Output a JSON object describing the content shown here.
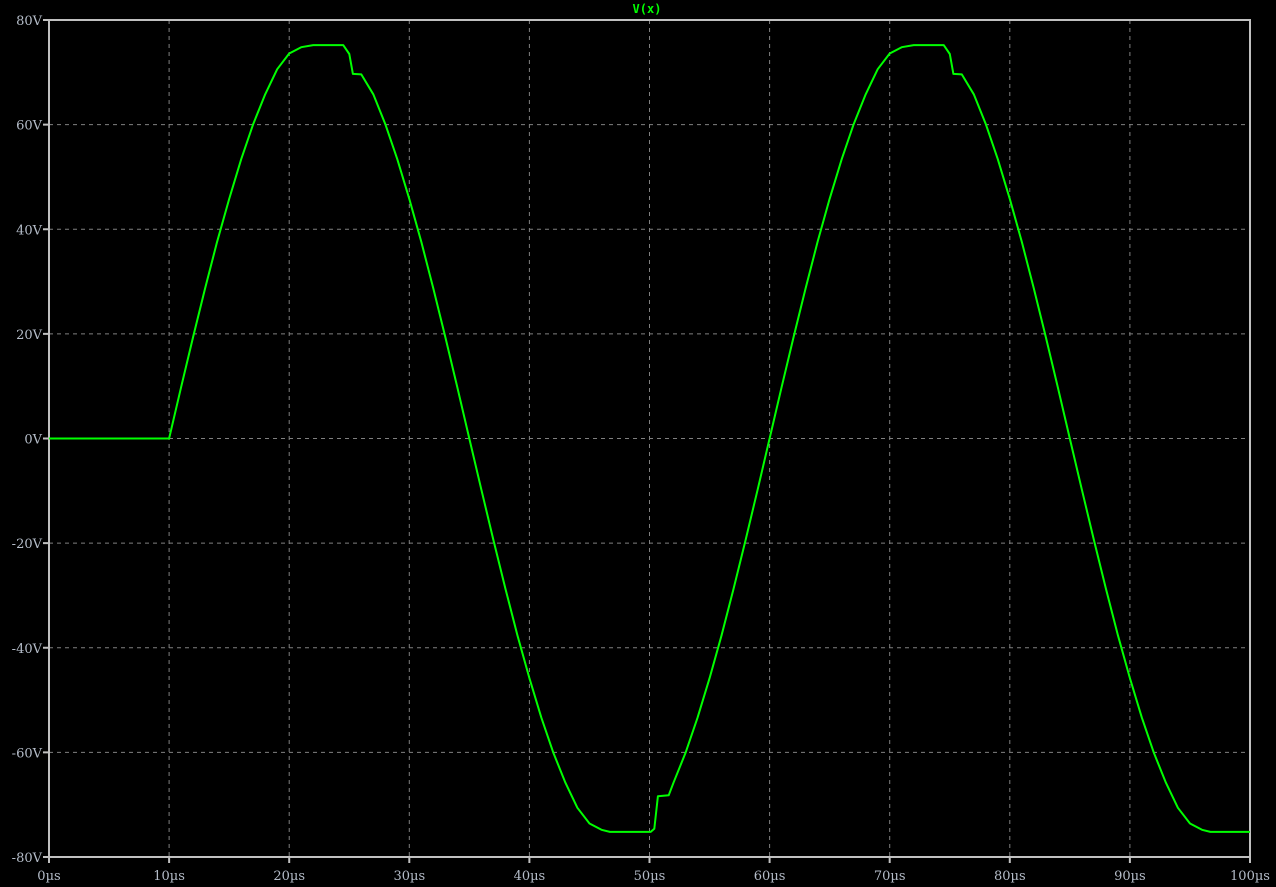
{
  "chart_data": {
    "type": "line",
    "title": "V(x)",
    "xlabel": "",
    "ylabel": "",
    "xlim": [
      0,
      100
    ],
    "ylim": [
      -80,
      80
    ],
    "x_unit": "µs",
    "y_unit": "V",
    "grid": true,
    "x_ticks": [
      0,
      10,
      20,
      30,
      40,
      50,
      60,
      70,
      80,
      90,
      100
    ],
    "y_ticks": [
      80,
      60,
      40,
      20,
      0,
      -20,
      -40,
      -60,
      -80
    ],
    "x_tick_labels": [
      "0µs",
      "10µs",
      "20µs",
      "30µs",
      "40µs",
      "50µs",
      "60µs",
      "70µs",
      "80µs",
      "90µs",
      "100µs"
    ],
    "y_tick_labels": [
      "80V",
      "60V",
      "40V",
      "20V",
      "0V",
      "-20V",
      "-40V",
      "-60V",
      "-80V"
    ],
    "colors": {
      "trace": "#00ff00",
      "grid": "#808080",
      "frame": "#c0c0c0",
      "background": "#000000",
      "tick_text": "#b4bcc8"
    },
    "series": [
      {
        "name": "V(x)",
        "points": [
          [
            0,
            0
          ],
          [
            10,
            0
          ],
          [
            11,
            9.8
          ],
          [
            12,
            19.4
          ],
          [
            13,
            28.7
          ],
          [
            14,
            37.6
          ],
          [
            15,
            45.8
          ],
          [
            16,
            53.4
          ],
          [
            17,
            60.1
          ],
          [
            18,
            65.8
          ],
          [
            19,
            70.6
          ],
          [
            20,
            73.6
          ],
          [
            21,
            74.8
          ],
          [
            22,
            75.2
          ],
          [
            24.5,
            75.2
          ],
          [
            25,
            73.5
          ],
          [
            25.3,
            69.7
          ],
          [
            26,
            69.6
          ],
          [
            27,
            65.8
          ],
          [
            28,
            60.1
          ],
          [
            29,
            53.4
          ],
          [
            30,
            45.8
          ],
          [
            31,
            37.6
          ],
          [
            32,
            28.7
          ],
          [
            33,
            19.4
          ],
          [
            34,
            9.8
          ],
          [
            35,
            0
          ],
          [
            36,
            -9.8
          ],
          [
            37,
            -19.4
          ],
          [
            38,
            -28.7
          ],
          [
            39,
            -37.6
          ],
          [
            40,
            -45.8
          ],
          [
            41,
            -53.4
          ],
          [
            42,
            -60.1
          ],
          [
            43,
            -65.8
          ],
          [
            44,
            -70.6
          ],
          [
            45,
            -73.6
          ],
          [
            46,
            -74.8
          ],
          [
            46.7,
            -75.2
          ],
          [
            50.1,
            -75.2
          ],
          [
            50.4,
            -74.6
          ],
          [
            50.7,
            -68.4
          ],
          [
            51.6,
            -68.2
          ],
          [
            52,
            -65.8
          ],
          [
            53,
            -60.1
          ],
          [
            54,
            -53.4
          ],
          [
            55,
            -45.8
          ],
          [
            56,
            -37.6
          ],
          [
            57,
            -28.7
          ],
          [
            58,
            -19.4
          ],
          [
            59,
            -9.8
          ],
          [
            60,
            0
          ],
          [
            61,
            9.8
          ],
          [
            62,
            19.4
          ],
          [
            63,
            28.7
          ],
          [
            64,
            37.6
          ],
          [
            65,
            45.8
          ],
          [
            66,
            53.4
          ],
          [
            67,
            60.1
          ],
          [
            68,
            65.8
          ],
          [
            69,
            70.6
          ],
          [
            70,
            73.6
          ],
          [
            71,
            74.8
          ],
          [
            72,
            75.2
          ],
          [
            74.5,
            75.2
          ],
          [
            75,
            73.5
          ],
          [
            75.3,
            69.7
          ],
          [
            76,
            69.6
          ],
          [
            77,
            65.8
          ],
          [
            78,
            60.1
          ],
          [
            79,
            53.4
          ],
          [
            80,
            45.8
          ],
          [
            81,
            37.6
          ],
          [
            82,
            28.7
          ],
          [
            83,
            19.4
          ],
          [
            84,
            9.8
          ],
          [
            85,
            0
          ],
          [
            86,
            -9.8
          ],
          [
            87,
            -19.4
          ],
          [
            88,
            -28.7
          ],
          [
            89,
            -37.6
          ],
          [
            90,
            -45.8
          ],
          [
            91,
            -53.4
          ],
          [
            92,
            -60.1
          ],
          [
            93,
            -65.8
          ],
          [
            94,
            -70.6
          ],
          [
            95,
            -73.6
          ],
          [
            96,
            -74.8
          ],
          [
            96.7,
            -75.2
          ],
          [
            100,
            -75.2
          ]
        ]
      }
    ]
  }
}
